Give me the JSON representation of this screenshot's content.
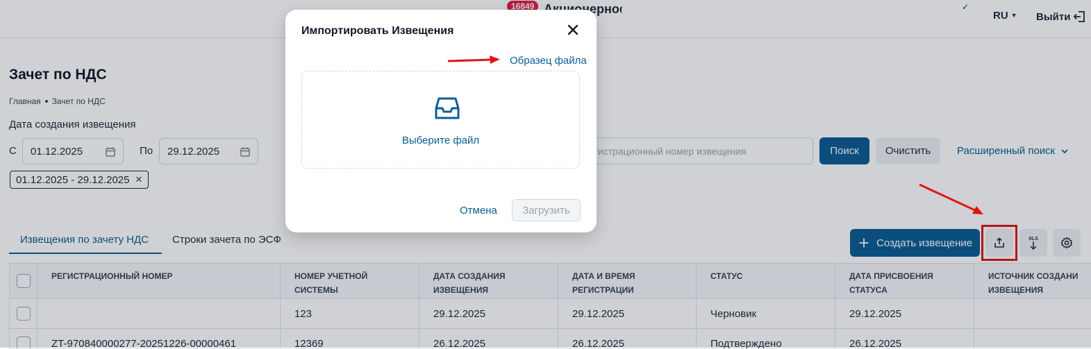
{
  "header": {
    "notification_count": "16849",
    "company_name": "Акционерное общество",
    "language": "RU",
    "logout_label": "Выйти"
  },
  "page": {
    "title": "Зачет по НДС",
    "breadcrumb": [
      "Главная",
      "Зачет по НДС"
    ]
  },
  "filters": {
    "date_label": "Дата создания извещения",
    "from_prefix": "С",
    "from_value": "01.12.2025",
    "to_prefix": "По",
    "to_value": "29.12.2025",
    "search_placeholder": "егистрационный номер извещения",
    "search_button": "Поиск",
    "clear_button": "Очистить",
    "advanced_search": "Расширенный поиск",
    "active_chip": "01.12.2025 - 29.12.2025"
  },
  "tabs": [
    {
      "label": "Извещения по зачету НДС",
      "active": true
    },
    {
      "label": "Строки зачета по ЭСФ",
      "active": false
    }
  ],
  "toolbar": {
    "create_button": "Создать извещение",
    "xls_label": "XLS"
  },
  "table": {
    "columns": [
      [
        "РЕГИСТРАЦИОННЫЙ НОМЕР"
      ],
      [
        "НОМЕР УЧЕТНОЙ",
        "СИСТЕМЫ"
      ],
      [
        "ДАТА СОЗДАНИЯ",
        "ИЗВЕЩЕНИЯ"
      ],
      [
        "ДАТА И ВРЕМЯ",
        "РЕГИСТРАЦИИ"
      ],
      [
        "СТАТУС"
      ],
      [
        "ДАТА ПРИСВОЕНИЯ",
        "СТАТУСА"
      ],
      [
        "ИСТОЧНИК СОЗДАНИ",
        "ИЗВЕЩЕНИЯ"
      ]
    ],
    "rows": [
      [
        "",
        "123",
        "29.12.2025",
        "29.12.2025",
        "Черновик",
        "29.12.2025",
        ""
      ],
      [
        "ZT-970840000277-20251226-00000461",
        "12369",
        "26.12.2025",
        "26.12.2025",
        "Подтверждено",
        "26.12.2025",
        ""
      ]
    ]
  },
  "modal": {
    "title": "Импортировать Извещения",
    "sample_link": "Образец файла",
    "dropzone_label": "Выберите файл",
    "cancel_button": "Отмена",
    "upload_button": "Загрузить"
  },
  "colors": {
    "primary": "#0b5c94",
    "annotation": "#e11414",
    "badge": "#e11d48"
  },
  "icons": [
    "calendar-icon",
    "close-icon",
    "chevron-down-icon",
    "plus-icon",
    "upload-icon",
    "xls-download-icon",
    "gear-icon",
    "inbox-icon",
    "logout-icon",
    "check-icon"
  ]
}
